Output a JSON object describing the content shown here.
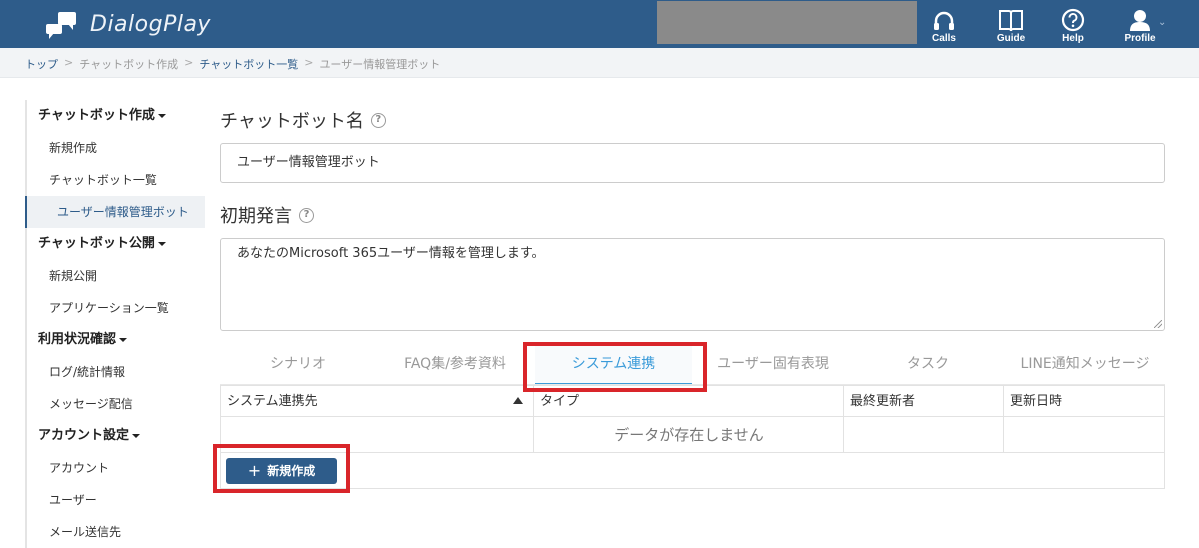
{
  "app": {
    "name": "DialogPlay"
  },
  "header": {
    "nav": [
      {
        "label": "Calls",
        "icon": "headset-icon"
      },
      {
        "label": "Guide",
        "icon": "book-icon"
      },
      {
        "label": "Help",
        "icon": "question-icon"
      },
      {
        "label": "Profile",
        "icon": "user-icon"
      }
    ]
  },
  "breadcrumb": [
    "トップ",
    "チャットボット作成",
    "チャットボット一覧",
    "ユーザー情報管理ボット"
  ],
  "sidebar": {
    "sections": [
      {
        "title": "チャットボット作成",
        "items": [
          "新規作成",
          "チャットボット一覧",
          "ユーザー情報管理ボット"
        ]
      },
      {
        "title": "チャットボット公開",
        "items": [
          "新規公開",
          "アプリケーション一覧"
        ]
      },
      {
        "title": "利用状況確認",
        "items": [
          "ログ/統計情報",
          "メッセージ配信"
        ]
      },
      {
        "title": "アカウント設定",
        "items": [
          "アカウント",
          "ユーザー",
          "メール送信先"
        ]
      }
    ]
  },
  "main": {
    "name_label": "チャットボット名",
    "name_value": "ユーザー情報管理ボット",
    "greeting_label": "初期発言",
    "greeting_value": "あなたのMicrosoft 365ユーザー情報を管理します。",
    "tabs": [
      "シナリオ",
      "FAQ集/参考資料",
      "システム連携",
      "ユーザー固有表現",
      "タスク",
      "LINE通知メッセージ"
    ],
    "active_tab": "システム連携",
    "table": {
      "columns": [
        "システム連携先",
        "タイプ",
        "最終更新者",
        "更新日時"
      ],
      "empty_message": "データが存在しません"
    },
    "new_button": "新規作成"
  },
  "colors": {
    "header": "#2e5c8a",
    "accent": "#3a9bd9",
    "highlight": "#d9252a"
  }
}
